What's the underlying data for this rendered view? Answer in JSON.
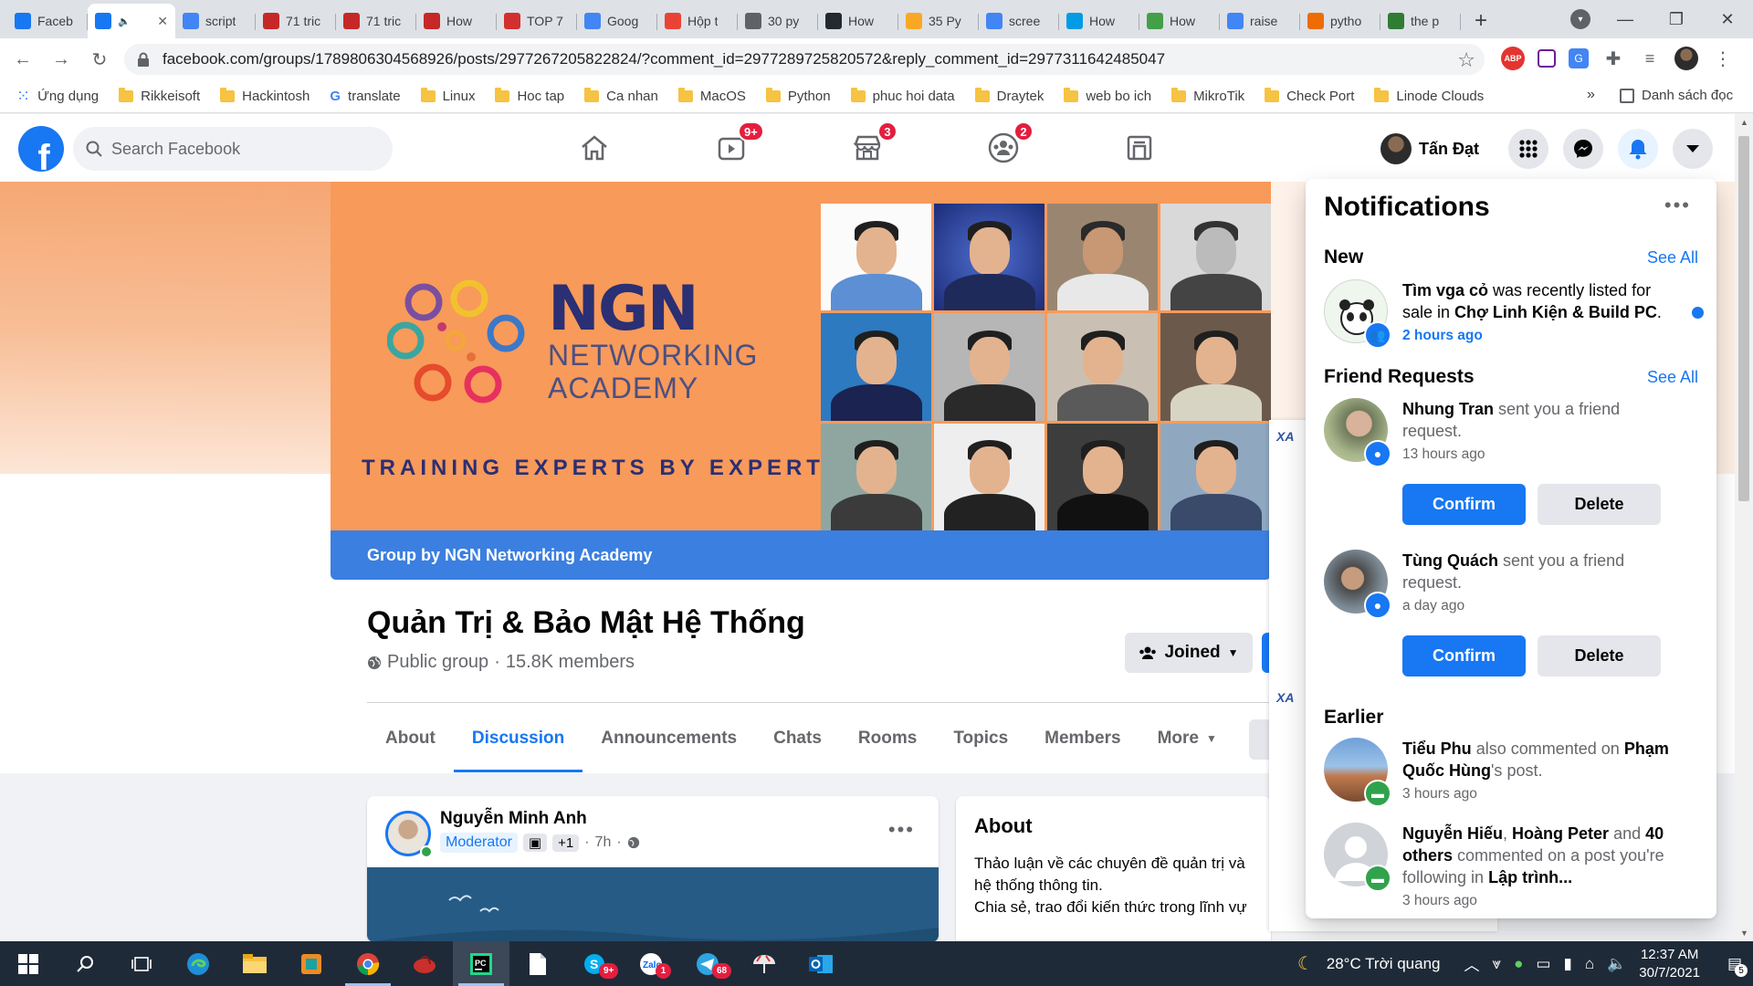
{
  "browser": {
    "tabs": [
      {
        "title": "Faceb",
        "icon": "facebook-icon",
        "color": "#1877f2"
      },
      {
        "title": "",
        "icon": "facebook-icon",
        "color": "#1877f2",
        "active": true
      },
      {
        "title": "script",
        "icon": "google-icon",
        "color": "#4285f4"
      },
      {
        "title": "71 tric",
        "icon": "t-icon",
        "color": "#c62828"
      },
      {
        "title": "71 tric",
        "icon": "t-icon",
        "color": "#c62828"
      },
      {
        "title": "How",
        "icon": "record-icon",
        "color": "#c62828"
      },
      {
        "title": "TOP 7",
        "icon": "ncb-icon",
        "color": "#d32f2f"
      },
      {
        "title": "Goog",
        "icon": "translate-icon",
        "color": "#4285f4"
      },
      {
        "title": "Hộp t",
        "icon": "gmail-icon",
        "color": "#ea4335"
      },
      {
        "title": "30 py",
        "icon": "globe-icon",
        "color": "#5f6368"
      },
      {
        "title": "How",
        "icon": "github-icon",
        "color": "#24292e"
      },
      {
        "title": "35 Py",
        "icon": "foss-icon",
        "color": "#f9a825"
      },
      {
        "title": "scree",
        "icon": "google-icon",
        "color": "#4285f4"
      },
      {
        "title": "How",
        "icon": "cloud-icon",
        "color": "#039be5"
      },
      {
        "title": "How",
        "icon": "link-icon",
        "color": "#43a047"
      },
      {
        "title": "raise",
        "icon": "google-icon",
        "color": "#4285f4"
      },
      {
        "title": "pytho",
        "icon": "flame-icon",
        "color": "#ef6c00"
      },
      {
        "title": "the p",
        "icon": "tool-icon",
        "color": "#2e7d32"
      }
    ],
    "new_tab_label": "+",
    "address": "facebook.com/groups/1789806304568926/posts/2977267205822824/?comment_id=2977289725820572&reply_comment_id=2977311642485047",
    "bookmarks": [
      {
        "label": "Ứng dụng",
        "type": "apps"
      },
      {
        "label": "Rikkeisoft",
        "type": "folder"
      },
      {
        "label": "Hackintosh",
        "type": "folder"
      },
      {
        "label": "translate",
        "type": "google"
      },
      {
        "label": "Linux",
        "type": "folder"
      },
      {
        "label": "Hoc tap",
        "type": "folder"
      },
      {
        "label": "Ca nhan",
        "type": "folder"
      },
      {
        "label": "MacOS",
        "type": "folder"
      },
      {
        "label": "Python",
        "type": "folder"
      },
      {
        "label": "phuc hoi data",
        "type": "folder"
      },
      {
        "label": "Draytek",
        "type": "folder"
      },
      {
        "label": "web bo ich",
        "type": "folder"
      },
      {
        "label": "MikroTik",
        "type": "folder"
      },
      {
        "label": "Check Port",
        "type": "folder"
      },
      {
        "label": "Linode Clouds",
        "type": "folder"
      }
    ],
    "bookmarks_overflow": "»",
    "reading_list": "Danh sách đọc",
    "ext_abp": "ABP"
  },
  "fb": {
    "search_placeholder": "Search Facebook",
    "nav_badges": {
      "watch": "9+",
      "marketplace": "3",
      "groups": "2"
    },
    "profile_name": "Tấn Đạt"
  },
  "cover": {
    "logo_big": "NGN",
    "logo_line1": "NETWORKING",
    "logo_line2": "ACADEMY",
    "slogan": "TRAINING EXPERTS BY EXPERTS",
    "group_by": "Group by NGN Networking Academy"
  },
  "group": {
    "name": "Quản Trị & Bảo Mật Hệ Thống",
    "privacy": "Public group",
    "members": "15.8K members",
    "joined_label": "Joined",
    "tabs": [
      "About",
      "Discussion",
      "Announcements",
      "Chats",
      "Rooms",
      "Topics",
      "Members",
      "More"
    ],
    "active_tab": "Discussion"
  },
  "post": {
    "author": "Nguyễn Minh Anh",
    "role": "Moderator",
    "plus": "+1",
    "time": "7h"
  },
  "about": {
    "title": "About",
    "line1": "Thảo luận về các chuyên đề quản trị và",
    "line2": "hệ thống thông tin.",
    "line3": "Chia sẻ, trao đổi kiến thức trong lĩnh vự"
  },
  "notifications": {
    "title": "Notifications",
    "new_label": "New",
    "see_all": "See All",
    "friend_requests_label": "Friend Requests",
    "earlier_label": "Earlier",
    "new_items": [
      {
        "actor": "Tìm vga cỏ",
        "text": "was recently listed for sale in",
        "target": "Chợ Linh Kiện & Build PC",
        "time": "2 hours ago",
        "unread": true
      }
    ],
    "friend_requests": [
      {
        "name": "Nhung Tran",
        "text": "sent you a friend request.",
        "time": "13 hours ago",
        "confirm": "Confirm",
        "delete": "Delete"
      },
      {
        "name": "Tùng Quách",
        "text": "sent you a friend request.",
        "time": "a day ago",
        "confirm": "Confirm",
        "delete": "Delete"
      }
    ],
    "earlier_items": [
      {
        "actor": "Tiểu Phu",
        "text1": "also commented on",
        "target": "Phạm Quốc Hùng",
        "text2": "'s post.",
        "time": "3 hours ago"
      },
      {
        "actor": "Nguyễn Hiếu",
        "sep": ", ",
        "actor2": "Hoàng Peter",
        "and": "and",
        "actor3": "40 others",
        "text": "commented on a post you're following in",
        "target": "Lập trình...",
        "time": "3 hours ago"
      }
    ]
  },
  "taskbar": {
    "weather": "28°C  Trời quang",
    "time": "12:37 AM",
    "date": "30/7/2021",
    "notif_count": "5",
    "skype_badge": "9+",
    "zalo_badge": "1",
    "telegram_badge": "68"
  }
}
